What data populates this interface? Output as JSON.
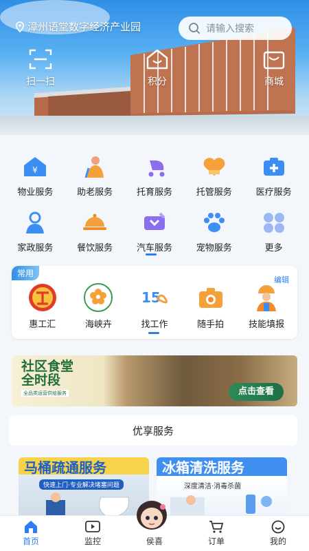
{
  "header": {
    "location": "漳州语堂数字经济产业园",
    "search_placeholder": "请输入搜索",
    "quick_actions": [
      {
        "label": "扫一扫",
        "icon": "scan-icon"
      },
      {
        "label": "积分",
        "icon": "points-icon"
      },
      {
        "label": "商城",
        "icon": "mall-icon"
      }
    ]
  },
  "services": {
    "row1": [
      {
        "label": "物业服务",
        "icon": "property-icon"
      },
      {
        "label": "助老服务",
        "icon": "elderly-icon"
      },
      {
        "label": "托育服务",
        "icon": "stroller-icon"
      },
      {
        "label": "托管服务",
        "icon": "care-icon"
      },
      {
        "label": "医疗服务",
        "icon": "medical-icon"
      }
    ],
    "row2": [
      {
        "label": "家政服务",
        "icon": "housekeeping-icon"
      },
      {
        "label": "餐饮服务",
        "icon": "dining-icon"
      },
      {
        "label": "汽车服务",
        "icon": "car-service-icon"
      },
      {
        "label": "宠物服务",
        "icon": "paw-icon"
      },
      {
        "label": "更多",
        "icon": "more-icon"
      }
    ]
  },
  "common": {
    "tag": "常用",
    "edit": "编辑",
    "items": [
      {
        "label": "惠工汇",
        "icon": "union-icon"
      },
      {
        "label": "海峡卉",
        "icon": "flower-icon"
      },
      {
        "label": "找工作",
        "icon": "job-icon"
      },
      {
        "label": "随手拍",
        "icon": "camera-icon"
      },
      {
        "label": "技能填报",
        "icon": "worker-icon"
      }
    ]
  },
  "banner": {
    "title_line1": "社区食堂",
    "title_line2": "全时段",
    "subtitle": "全品类运营供给服务",
    "button": "点击查看"
  },
  "preferred": {
    "title": "优享服务",
    "promos": [
      {
        "title": "马桶疏通服务",
        "subtitle": "快速上门·专业解决堵塞问题"
      },
      {
        "title": "冰箱清洗服务",
        "subtitle": "深度清洁·消毒杀菌"
      }
    ]
  },
  "tabbar": {
    "items": [
      {
        "label": "首页",
        "active": true
      },
      {
        "label": "监控",
        "active": false
      },
      {
        "label": "侯喜",
        "active": false
      },
      {
        "label": "订单",
        "active": false
      },
      {
        "label": "我的",
        "active": false
      }
    ]
  },
  "colors": {
    "accent": "#2f7cf6",
    "icon_blue": "#3b8ef3",
    "icon_orange": "#f5a13a",
    "icon_purple": "#8b6df0"
  }
}
